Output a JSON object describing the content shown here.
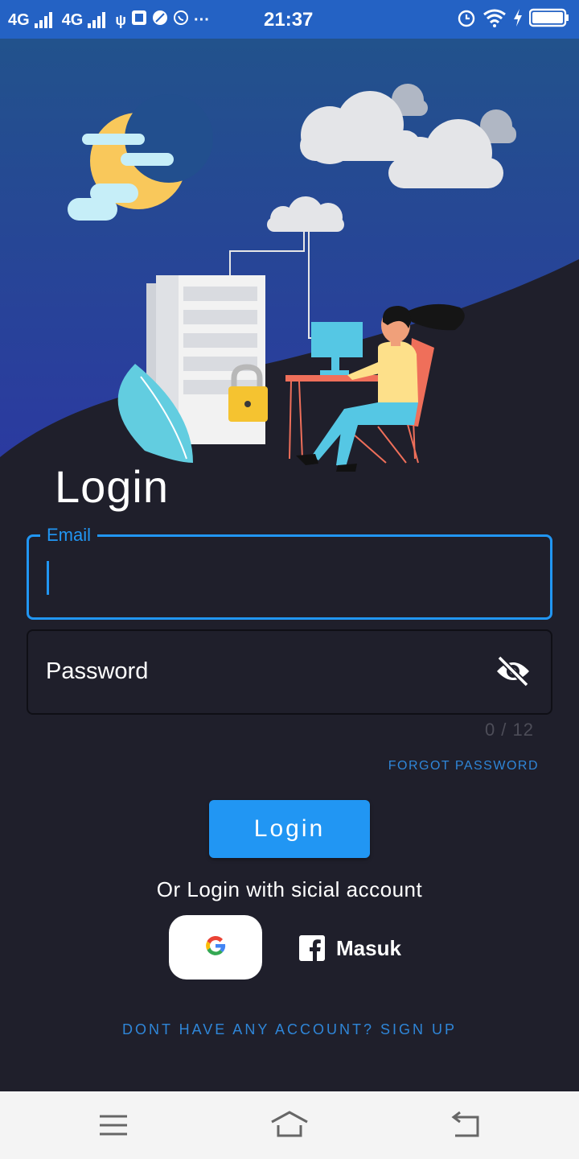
{
  "status_bar": {
    "network_1": "4G",
    "network_2": "4G",
    "time": "21:37",
    "notification_overflow": "···"
  },
  "page": {
    "title": "Login"
  },
  "form": {
    "email_label": "Email",
    "email_value": "",
    "password_label": "Password",
    "password_counter": "0 / 12",
    "forgot_password": "FORGOT PASSWORD",
    "login_button": "Login"
  },
  "social": {
    "prompt": "Or Login with sicial account",
    "google_icon": "google-g-icon",
    "facebook_label": "Masuk"
  },
  "signup": {
    "text": "DONT HAVE ANY ACCOUNT? SIGN UP"
  },
  "colors": {
    "status_bar": "#2462c4",
    "background": "#1f1f2b",
    "accent": "#2196f3",
    "link": "#2f86d8"
  },
  "nav_bar": {
    "icons": [
      "menu-icon",
      "home-icon",
      "back-icon"
    ]
  }
}
